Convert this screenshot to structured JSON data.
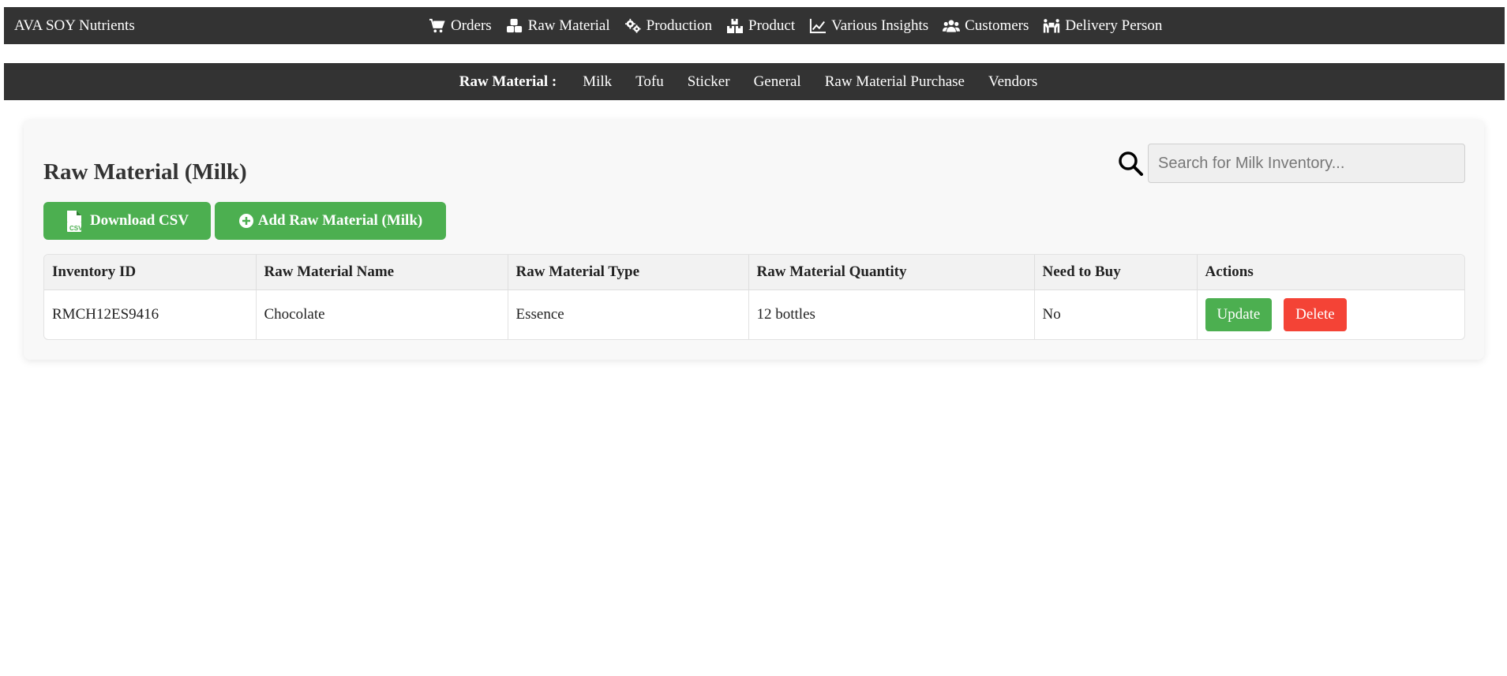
{
  "app": {
    "brand": "AVA SOY Nutrients"
  },
  "topnav": [
    {
      "label": "Orders",
      "icon": "cart-icon"
    },
    {
      "label": "Raw Material",
      "icon": "cubes-icon"
    },
    {
      "label": "Production",
      "icon": "gears-icon"
    },
    {
      "label": "Product",
      "icon": "boxes-icon"
    },
    {
      "label": "Various Insights",
      "icon": "chart-line-icon"
    },
    {
      "label": "Customers",
      "icon": "users-icon"
    },
    {
      "label": "Delivery Person",
      "icon": "people-carry-icon"
    }
  ],
  "subnav": {
    "title": "Raw Material :",
    "items": [
      "Milk",
      "Tofu",
      "Sticker",
      "General",
      "Raw Material Purchase",
      "Vendors"
    ]
  },
  "main": {
    "title": "Raw Material (Milk)",
    "search_placeholder": "Search for Milk Inventory...",
    "download_label": "Download CSV",
    "add_label": "Add Raw Material (Milk)"
  },
  "table": {
    "headers": [
      "Inventory ID",
      "Raw Material Name",
      "Raw Material Type",
      "Raw Material Quantity",
      "Need to Buy",
      "Actions"
    ],
    "rows": [
      {
        "id": "RMCH12ES9416",
        "name": "Chocolate",
        "type": "Essence",
        "quantity": "12 bottles",
        "need": "No",
        "update": "Update",
        "delete": "Delete"
      }
    ]
  },
  "colors": {
    "nav_bg": "#333333",
    "primary": "#4caf50",
    "danger": "#f44336"
  }
}
